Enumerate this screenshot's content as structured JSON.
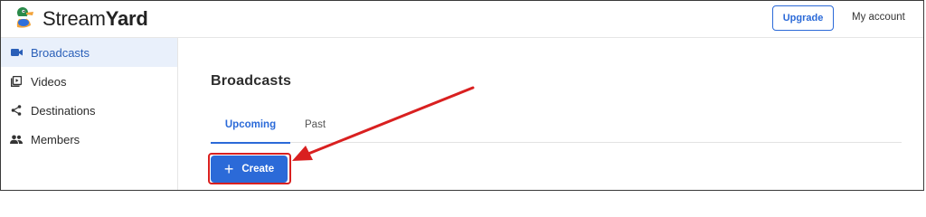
{
  "app": {
    "name_regular": "Stream",
    "name_bold": "Yard",
    "logo_icon": "duck-logo-icon"
  },
  "header": {
    "upgrade_label": "Upgrade",
    "account_label": "My account",
    "accent_color": "#2b6ad8"
  },
  "sidebar": {
    "items": [
      {
        "label": "Broadcasts",
        "icon": "video-camera-icon",
        "active": true
      },
      {
        "label": "Videos",
        "icon": "video-library-icon",
        "active": false
      },
      {
        "label": "Destinations",
        "icon": "share-icon",
        "active": false
      },
      {
        "label": "Members",
        "icon": "people-icon",
        "active": false
      }
    ]
  },
  "main": {
    "title": "Broadcasts",
    "tabs": [
      {
        "label": "Upcoming",
        "active": true
      },
      {
        "label": "Past",
        "active": false
      }
    ],
    "create_label": "Create",
    "create_icon": "plus-icon"
  },
  "annotation": {
    "color": "#d92020",
    "shape": "arrow-to-highlighted-box"
  }
}
